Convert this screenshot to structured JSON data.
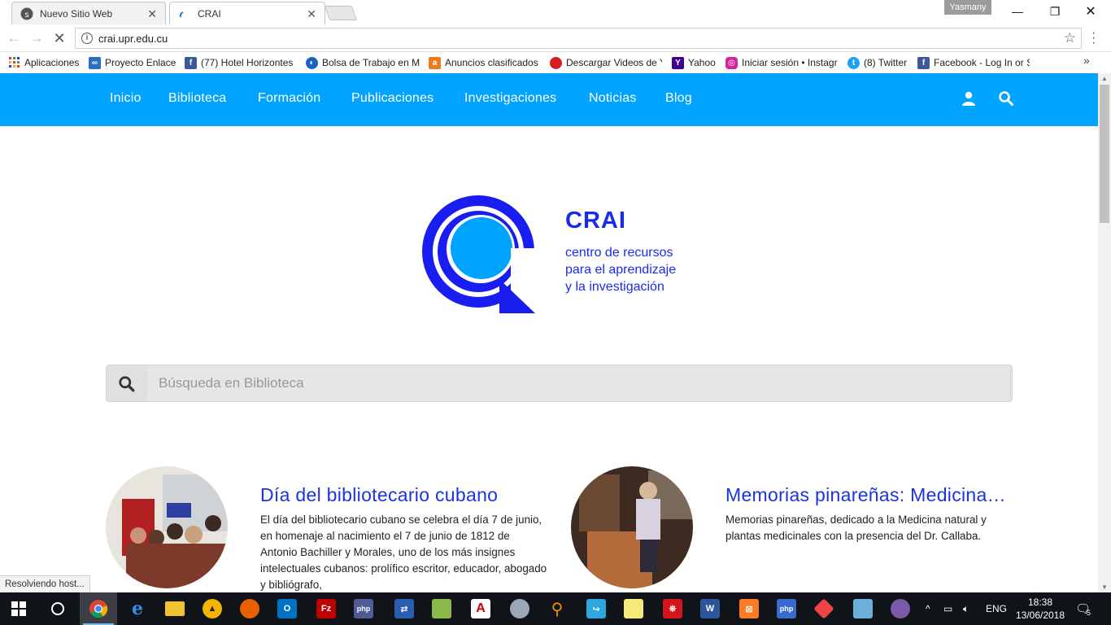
{
  "browser": {
    "tabs": [
      {
        "label": "Nuevo Sitio Web",
        "active": false
      },
      {
        "label": "CRAI",
        "active": true
      }
    ],
    "profile_name": "Yasmany",
    "url": "crai.upr.edu.cu",
    "status_text": "Resolviendo host..."
  },
  "bookmarks": {
    "items": [
      {
        "label": "Aplicaciones",
        "icon": "apps-grid-icon"
      },
      {
        "label": "Proyecto Enlace",
        "icon": "link-icon"
      },
      {
        "label": "(77) Hotel Horizontes",
        "icon": "facebook-icon"
      },
      {
        "label": "Bolsa de Trabajo en M",
        "icon": "globe-icon"
      },
      {
        "label": "Anuncios clasificados",
        "icon": "classifieds-icon"
      },
      {
        "label": "Descargar Videos de Y",
        "icon": "tomato-icon"
      },
      {
        "label": "Yahoo",
        "icon": "yahoo-icon"
      },
      {
        "label": "Iniciar sesión • Instagr",
        "icon": "instagram-icon"
      },
      {
        "label": "(8) Twitter",
        "icon": "twitter-icon"
      },
      {
        "label": "Facebook - Log In or S",
        "icon": "facebook-icon"
      }
    ]
  },
  "site": {
    "nav": [
      "Inicio",
      "Biblioteca",
      "Formación",
      "Publicaciones",
      "Investigaciones",
      "Noticias",
      "Blog"
    ],
    "brand_name": "CRAI",
    "brand_tagline": [
      "centro de recursos",
      "para el aprendizaje",
      "y la investigación"
    ],
    "search_placeholder": "Búsqueda en Biblioteca",
    "accent_color": "#00a3ff",
    "brand_color": "#1a2bf0"
  },
  "posts": [
    {
      "title": "Día del bibliotecario cubano",
      "excerpt": "El día del bibliotecario cubano se celebra el día 7 de junio, en homenaje al nacimiento el 7 de junio de 1812 de Antonio Bachiller y Morales, uno de los más insignes intelectuales cubanos: prolífico escritor, educador, abogado y bibliógrafo,"
    },
    {
      "title": "Memorias pinareñas: Medicina natural y plantas medicinales",
      "excerpt": "Memorias pinareñas, dedicado a la Medicina natural y plantas medicinales con la presencia del Dr. Callaba."
    }
  ],
  "taskbar": {
    "apps": [
      "chrome",
      "edge",
      "file-explorer",
      "java",
      "firefox",
      "outlook",
      "filezilla",
      "php",
      "network",
      "notes",
      "autocad",
      "scanner",
      "search-tool",
      "remote-desktop",
      "sticky-notes",
      "acrobat",
      "word",
      "xampp",
      "php-designer",
      "git",
      "explorer-app",
      "pgadmin"
    ],
    "tray_language": "ENG",
    "time": "18:38",
    "date": "13/06/2018",
    "notification_count": "5"
  }
}
